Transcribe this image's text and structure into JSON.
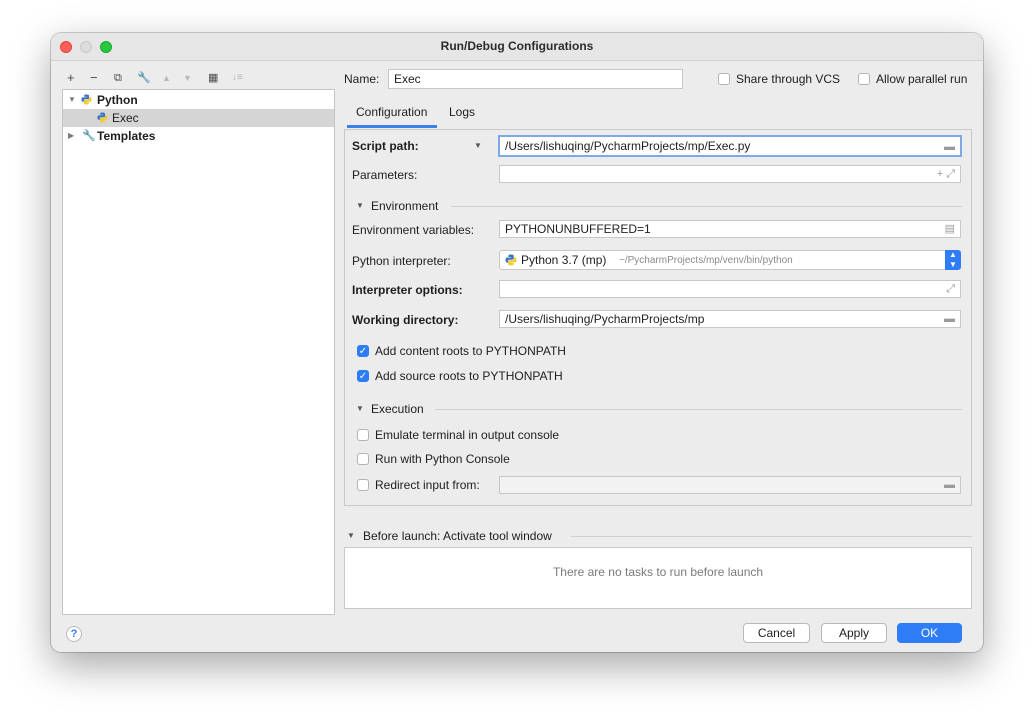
{
  "window": {
    "title": "Run/Debug Configurations"
  },
  "toolbar": {
    "add": "+",
    "remove": "−",
    "copy": "⧉",
    "edit": "🔧",
    "up": "▲",
    "down": "▼",
    "folder": "▦",
    "sort": "↓≡"
  },
  "tree": {
    "python_label": "Python",
    "exec_label": "Exec",
    "templates_label": "Templates"
  },
  "header": {
    "name_label": "Name:",
    "name_value": "Exec",
    "share_vcs_label": "Share through VCS",
    "allow_parallel_label": "Allow parallel run"
  },
  "tabs": [
    {
      "label": "Configuration"
    },
    {
      "label": "Logs"
    }
  ],
  "config": {
    "script_path_label": "Script path:",
    "script_path_value": "/Users/lishuqing/PycharmProjects/mp/Exec.py",
    "parameters_label": "Parameters:",
    "parameters_value": "",
    "environment_section": "Environment",
    "env_vars_label": "Environment variables:",
    "env_vars_value": "PYTHONUNBUFFERED=1",
    "interpreter_label": "Python interpreter:",
    "interpreter_name": "Python 3.7 (mp)",
    "interpreter_path": "~/PycharmProjects/mp/venv/bin/python",
    "interpreter_options_label": "Interpreter options:",
    "interpreter_options_value": "",
    "working_dir_label": "Working directory:",
    "working_dir_value": "/Users/lishuqing/PycharmProjects/mp",
    "content_roots_label": "Add content roots to PYTHONPATH",
    "source_roots_label": "Add source roots to PYTHONPATH",
    "execution_section": "Execution",
    "emulate_terminal_label": "Emulate terminal in output console",
    "python_console_label": "Run with Python Console",
    "redirect_input_label": "Redirect input from:"
  },
  "before_launch": {
    "title": "Before launch: Activate tool window",
    "empty_text": "There are no tasks to run before launch"
  },
  "footer": {
    "help": "?",
    "cancel": "Cancel",
    "apply": "Apply",
    "ok": "OK"
  },
  "colors": {
    "accent": "#2f7df6",
    "selection": "#d5d5d5"
  },
  "icons": [
    "add-icon",
    "remove-icon",
    "copy-icon",
    "wrench-icon",
    "arrow-up-icon",
    "arrow-down-icon",
    "folder-icon",
    "sort-icon",
    "python-icon",
    "wrench-icon",
    "folder-browse-icon",
    "expand-icon",
    "help-icon"
  ]
}
